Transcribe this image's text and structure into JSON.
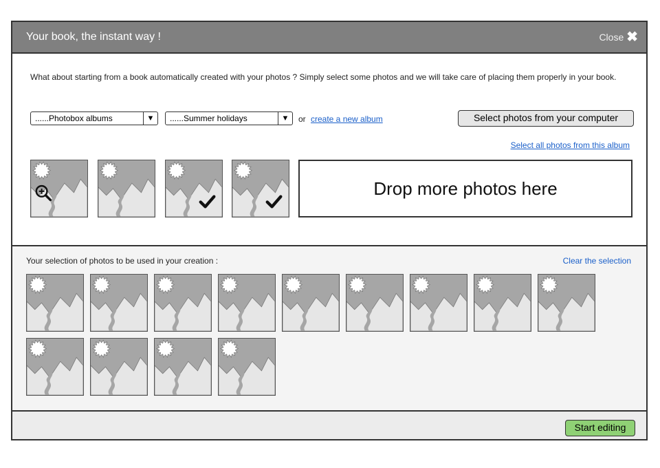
{
  "dialog": {
    "title": "Your book, the instant way !",
    "close_label": "Close",
    "close_icon": "close-icon"
  },
  "top": {
    "intro_text": "What about starting from a book automatically created with your photos ? Simply select some photos and we will take care of placing them properly in your book.",
    "source_select": {
      "value": "......Photobox albums"
    },
    "album_select": {
      "value": "......Summer holidays"
    },
    "or_text": "or",
    "create_album_link": "create a new album",
    "select_computer_button": "Select photos from your computer",
    "select_all_link": "Select all photos from this album",
    "drop_zone_text": "Drop more photos here",
    "photos": [
      {
        "zoom": true,
        "checked": false
      },
      {
        "zoom": false,
        "checked": false
      },
      {
        "zoom": false,
        "checked": true
      },
      {
        "zoom": false,
        "checked": true
      }
    ]
  },
  "selection": {
    "label": "Your selection of photos to be used in your creation :",
    "clear_link": "Clear the selection",
    "photo_count": 13
  },
  "footer": {
    "start_button": "Start editing"
  },
  "colors": {
    "titlebar": "#808080",
    "start_button": "#8fd175",
    "link": "#1a5fc9"
  }
}
